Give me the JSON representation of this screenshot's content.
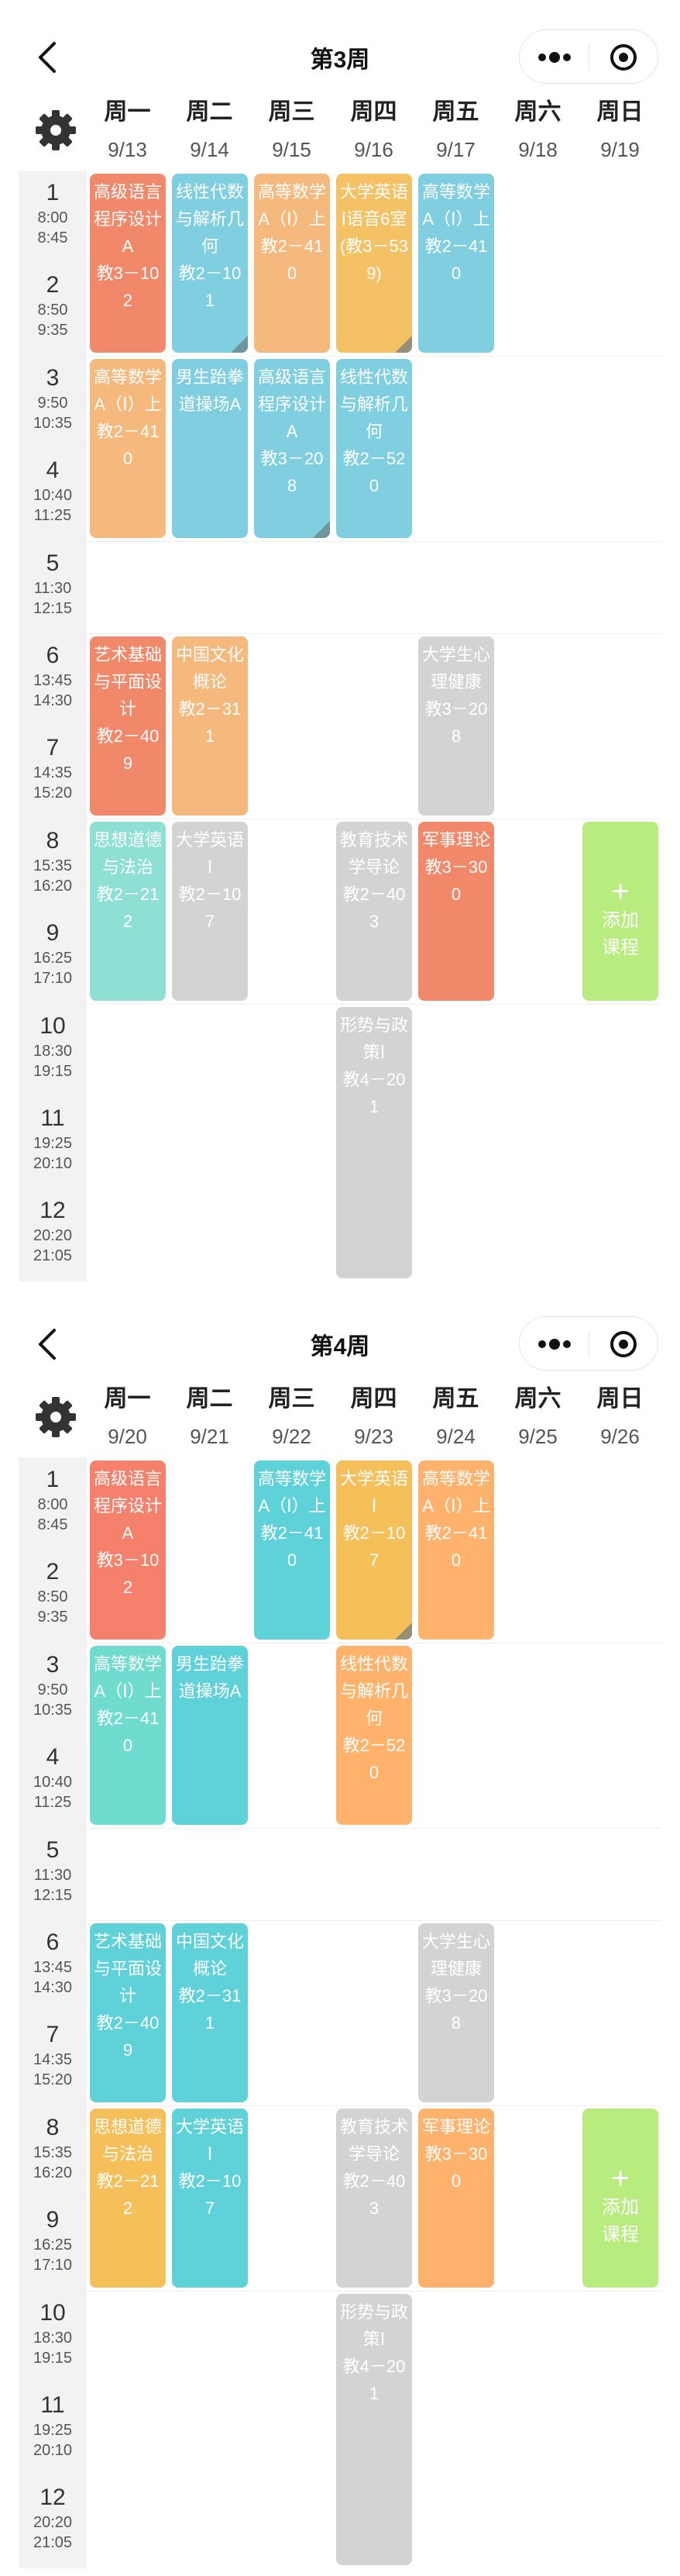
{
  "weeks": [
    {
      "title": "第3周",
      "days": [
        {
          "name": "周一",
          "date": "9/13"
        },
        {
          "name": "周二",
          "date": "9/14"
        },
        {
          "name": "周三",
          "date": "9/15"
        },
        {
          "name": "周四",
          "date": "9/16"
        },
        {
          "name": "周五",
          "date": "9/17"
        },
        {
          "name": "周六",
          "date": "9/18"
        },
        {
          "name": "周日",
          "date": "9/19"
        }
      ],
      "courses": [
        {
          "text": "高级语言程序设计A\n教3－102",
          "day": 0,
          "start": 1,
          "span": 2,
          "color": "#f2886a",
          "gray": false,
          "corner": false
        },
        {
          "text": "线性代数与解析几何\n教2－101",
          "day": 1,
          "start": 1,
          "span": 2,
          "color": "#7fcfe0",
          "gray": false,
          "corner": true
        },
        {
          "text": "高等数学A（Ⅰ）上\n教2－410",
          "day": 2,
          "start": 1,
          "span": 2,
          "color": "#f5b87d",
          "gray": false,
          "corner": false
        },
        {
          "text": "大学英语Ⅰ语音6室(教3－539)",
          "day": 3,
          "start": 1,
          "span": 2,
          "color": "#f4c164",
          "gray": false,
          "corner": true
        },
        {
          "text": "高等数学A（Ⅰ）上\n教2－410",
          "day": 4,
          "start": 1,
          "span": 2,
          "color": "#7fcfe0",
          "gray": false,
          "corner": false
        },
        {
          "text": "高等数学A（Ⅰ）上\n教2－410",
          "day": 0,
          "start": 3,
          "span": 2,
          "color": "#f5b87d",
          "gray": false,
          "corner": false
        },
        {
          "text": "男生跆拳道操场A",
          "day": 1,
          "start": 3,
          "span": 2,
          "color": "#7fcfe0",
          "gray": false,
          "corner": false
        },
        {
          "text": "高级语言程序设计A\n教3－208",
          "day": 2,
          "start": 3,
          "span": 2,
          "color": "#7fcfe0",
          "gray": false,
          "corner": true
        },
        {
          "text": "线性代数与解析几何\n教2－520",
          "day": 3,
          "start": 3,
          "span": 2,
          "color": "#7fcfe0",
          "gray": false,
          "corner": false
        },
        {
          "text": "艺术基础与平面设计\n教2－409",
          "day": 0,
          "start": 6,
          "span": 2,
          "color": "#f2886a",
          "gray": false,
          "corner": false
        },
        {
          "text": "中国文化概论\n教2－311",
          "day": 1,
          "start": 6,
          "span": 2,
          "color": "#f5b87d",
          "gray": false,
          "corner": false
        },
        {
          "text": "大学生心理健康\n教3－208",
          "day": 4,
          "start": 6,
          "span": 2,
          "color": "#d3d3d3",
          "gray": true,
          "corner": false
        },
        {
          "text": "思想道德与法治\n教2－212",
          "day": 0,
          "start": 8,
          "span": 2,
          "color": "#8fe0d4",
          "gray": false,
          "corner": false
        },
        {
          "text": "大学英语Ⅰ\n教2－107",
          "day": 1,
          "start": 8,
          "span": 2,
          "color": "#d3d3d3",
          "gray": true,
          "corner": false
        },
        {
          "text": "教育技术学导论\n教2－403",
          "day": 3,
          "start": 8,
          "span": 2,
          "color": "#d3d3d3",
          "gray": true,
          "corner": false
        },
        {
          "text": "军事理论\n教3－300",
          "day": 4,
          "start": 8,
          "span": 2,
          "color": "#f2886a",
          "gray": false,
          "corner": false
        },
        {
          "text": "形势与政策Ⅰ\n教4－201",
          "day": 3,
          "start": 10,
          "span": 3,
          "color": "#d3d3d3",
          "gray": true,
          "corner": false
        }
      ],
      "add": {
        "plus": "+",
        "label": "添加\n课程",
        "day": 6,
        "start": 8,
        "span": 2
      }
    },
    {
      "title": "第4周",
      "days": [
        {
          "name": "周一",
          "date": "9/20"
        },
        {
          "name": "周二",
          "date": "9/21"
        },
        {
          "name": "周三",
          "date": "9/22"
        },
        {
          "name": "周四",
          "date": "9/23"
        },
        {
          "name": "周五",
          "date": "9/24"
        },
        {
          "name": "周六",
          "date": "9/25"
        },
        {
          "name": "周日",
          "date": "9/26"
        }
      ],
      "courses": [
        {
          "text": "高级语言程序设计A\n教3－102",
          "day": 0,
          "start": 1,
          "span": 2,
          "color": "#f5806c",
          "gray": false,
          "corner": false
        },
        {
          "text": "高等数学A（Ⅰ）上\n教2－410",
          "day": 2,
          "start": 1,
          "span": 2,
          "color": "#5fd1d9",
          "gray": false,
          "corner": false
        },
        {
          "text": "大学英语Ⅰ\n教2－107",
          "day": 3,
          "start": 1,
          "span": 2,
          "color": "#f5c05a",
          "gray": false,
          "corner": true
        },
        {
          "text": "高等数学A（Ⅰ）上\n教2－410",
          "day": 4,
          "start": 1,
          "span": 2,
          "color": "#ffb26b",
          "gray": false,
          "corner": false
        },
        {
          "text": "高等数学A（Ⅰ）上\n教2－410",
          "day": 0,
          "start": 3,
          "span": 2,
          "color": "#6fdccf",
          "gray": false,
          "corner": false
        },
        {
          "text": "男生跆拳道操场A",
          "day": 1,
          "start": 3,
          "span": 2,
          "color": "#5fd1d9",
          "gray": false,
          "corner": false
        },
        {
          "text": "线性代数与解析几何\n教2－520",
          "day": 3,
          "start": 3,
          "span": 2,
          "color": "#ffb26b",
          "gray": false,
          "corner": false
        },
        {
          "text": "艺术基础与平面设计\n教2－409",
          "day": 0,
          "start": 6,
          "span": 2,
          "color": "#5fd1d9",
          "gray": false,
          "corner": false
        },
        {
          "text": "中国文化概论\n教2－311",
          "day": 1,
          "start": 6,
          "span": 2,
          "color": "#5fd1d9",
          "gray": false,
          "corner": false
        },
        {
          "text": "大学生心理健康\n教3－208",
          "day": 4,
          "start": 6,
          "span": 2,
          "color": "#d3d3d3",
          "gray": true,
          "corner": false
        },
        {
          "text": "思想道德与法治\n教2－212",
          "day": 0,
          "start": 8,
          "span": 2,
          "color": "#f5c05a",
          "gray": false,
          "corner": false
        },
        {
          "text": "大学英语Ⅰ\n教2－107",
          "day": 1,
          "start": 8,
          "span": 2,
          "color": "#5fd1d9",
          "gray": false,
          "corner": false
        },
        {
          "text": "教育技术学导论\n教2－403",
          "day": 3,
          "start": 8,
          "span": 2,
          "color": "#d3d3d3",
          "gray": true,
          "corner": false
        },
        {
          "text": "军事理论\n教3－300",
          "day": 4,
          "start": 8,
          "span": 2,
          "color": "#ffb26b",
          "gray": false,
          "corner": false
        },
        {
          "text": "形势与政策Ⅰ\n教4－201",
          "day": 3,
          "start": 10,
          "span": 3,
          "color": "#d3d3d3",
          "gray": true,
          "corner": false
        }
      ],
      "add": {
        "plus": "+",
        "label": "添加\n课程",
        "day": 6,
        "start": 8,
        "span": 2
      }
    }
  ],
  "periods": [
    {
      "num": "1",
      "start": "8:00",
      "end": "8:45"
    },
    {
      "num": "2",
      "start": "8:50",
      "end": "9:35"
    },
    {
      "num": "3",
      "start": "9:50",
      "end": "10:35"
    },
    {
      "num": "4",
      "start": "10:40",
      "end": "11:25"
    },
    {
      "num": "5",
      "start": "11:30",
      "end": "12:15"
    },
    {
      "num": "6",
      "start": "13:45",
      "end": "14:30"
    },
    {
      "num": "7",
      "start": "14:35",
      "end": "15:20"
    },
    {
      "num": "8",
      "start": "15:35",
      "end": "16:20"
    },
    {
      "num": "9",
      "start": "16:25",
      "end": "17:10"
    },
    {
      "num": "10",
      "start": "18:30",
      "end": "19:15"
    },
    {
      "num": "11",
      "start": "19:25",
      "end": "20:10"
    },
    {
      "num": "12",
      "start": "20:20",
      "end": "21:05"
    }
  ],
  "icons": {
    "back": "chevron-left-icon",
    "more": "more-dots-icon",
    "close": "target-circle-icon",
    "settings": "gear-icon"
  },
  "colors": {
    "grid_line": "#efefef",
    "period_bg": "#f2f2f2",
    "add_course": "#b8ec7e"
  }
}
